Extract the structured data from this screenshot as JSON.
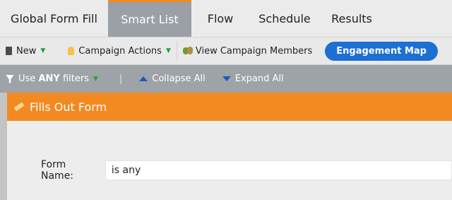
{
  "tabs": [
    {
      "label": "Global Form Fill",
      "active": false
    },
    {
      "label": "Smart List",
      "active": true
    },
    {
      "label": "Flow",
      "active": false
    },
    {
      "label": "Schedule",
      "active": false
    },
    {
      "label": "Results",
      "active": false
    }
  ],
  "toolbar": {
    "new_label": "New",
    "campaign_actions_label": "Campaign Actions",
    "view_members_label": "View Campaign Members",
    "engagement_map_label": "Engagement Map"
  },
  "filterbar": {
    "use_prefix": "Use",
    "use_any": "ANY",
    "use_suffix": "filters",
    "separator": "|",
    "collapse_all": "Collapse All",
    "expand_all": "Expand All"
  },
  "filter": {
    "title": "Fills Out Form",
    "form_name_label": "Form Name:",
    "form_name_value": "is any"
  },
  "colors": {
    "accent_orange": "#f28a22",
    "button_blue": "#1c6fd3"
  }
}
